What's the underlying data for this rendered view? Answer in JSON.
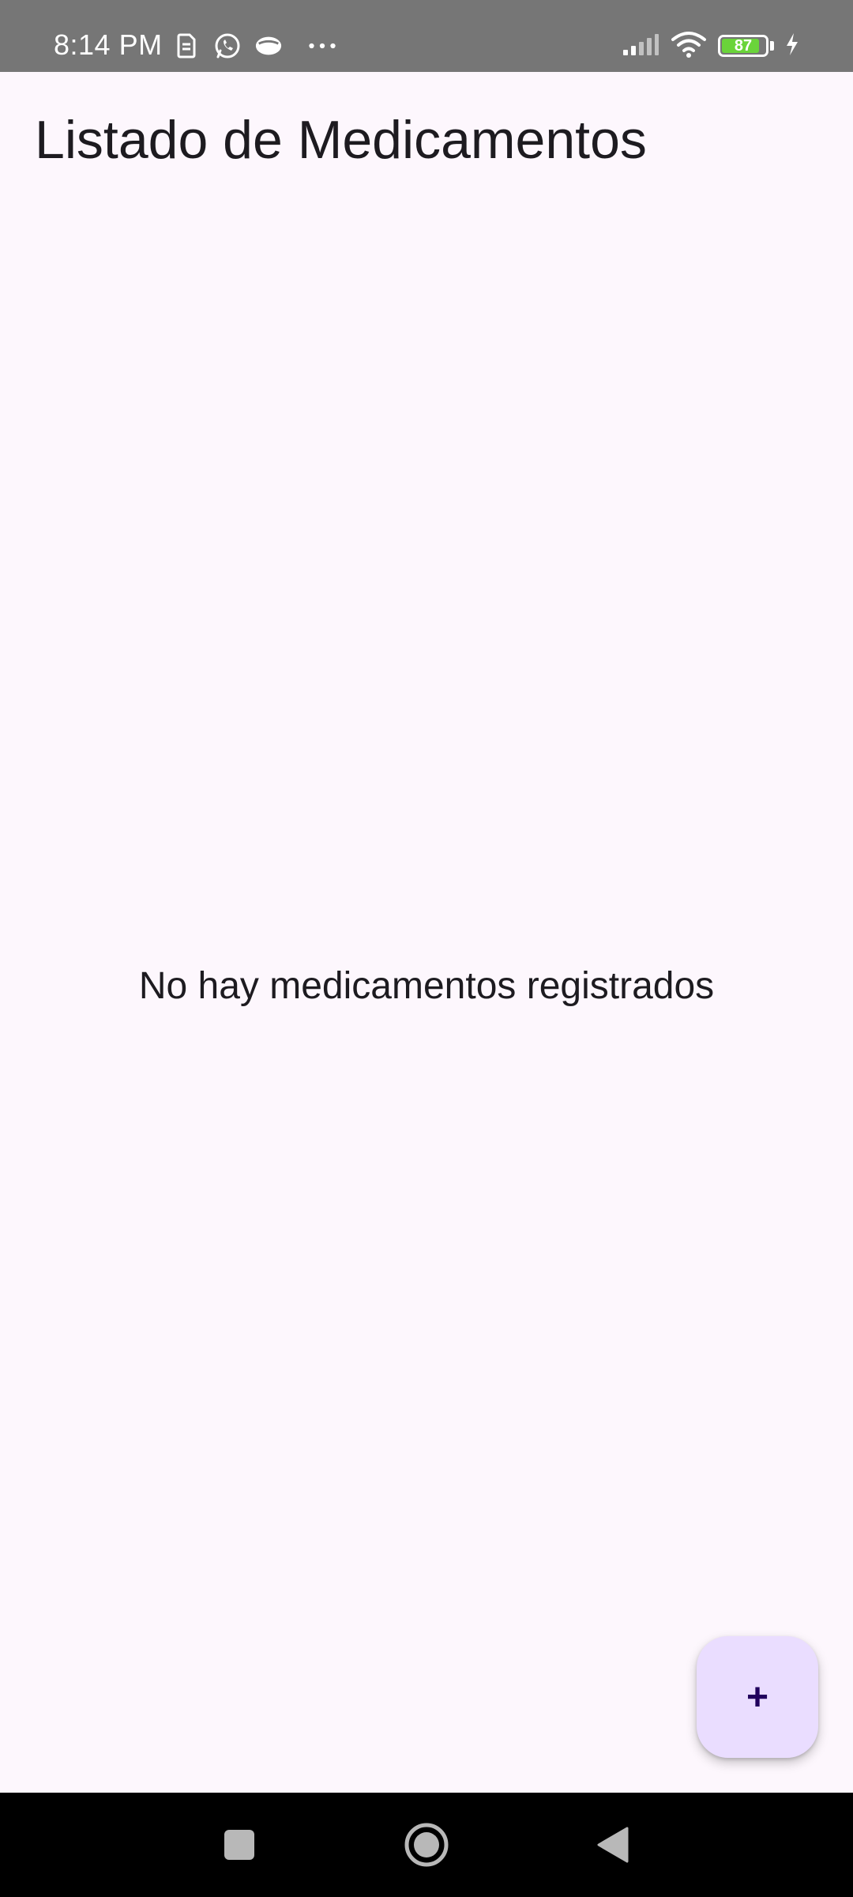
{
  "status_bar": {
    "time": "8:14 PM",
    "left_icons": [
      "sim-card-icon",
      "whatsapp-icon",
      "mask-app-icon",
      "more-dots-icon"
    ],
    "right_icons": [
      "signal-icon",
      "wifi-icon",
      "battery-icon",
      "charging-icon"
    ],
    "battery_level": "87",
    "battery_fill_fraction": 0.87,
    "bar_color": "#767676",
    "battery_color": "#6ad43a"
  },
  "app_bar": {
    "title": "Listado de Medicamentos"
  },
  "main": {
    "empty_message": "No hay medicamentos registrados",
    "background_color": "#fdf7fd"
  },
  "fab": {
    "label": "+",
    "background_color": "#eaddff",
    "icon_color": "#21005d"
  },
  "nav_bar": {
    "buttons": [
      "recents-square-icon",
      "home-circle-icon",
      "back-triangle-icon"
    ]
  }
}
